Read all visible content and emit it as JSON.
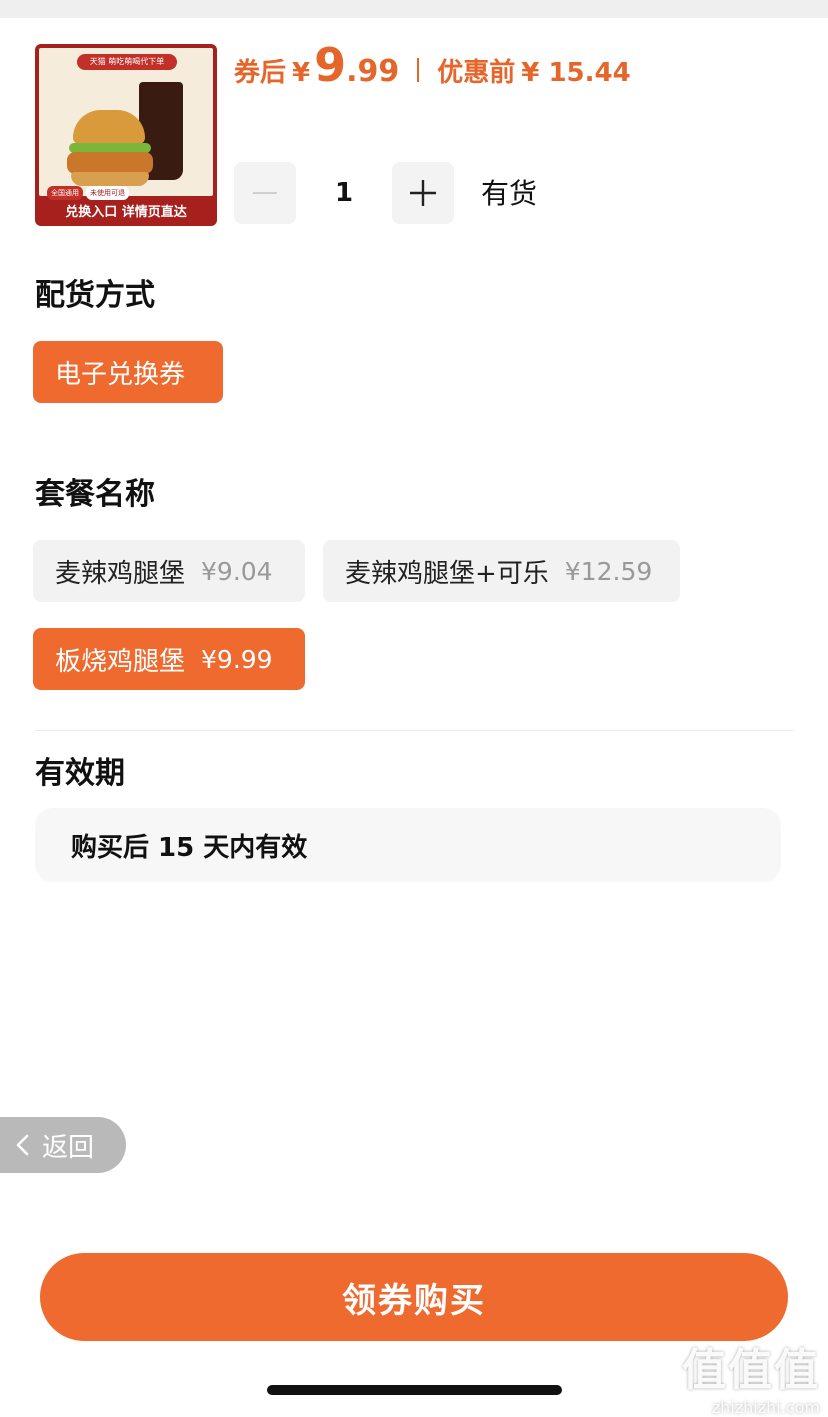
{
  "product": {
    "image_banner": "天猫 萌吃萌喝代下单",
    "image_tags": [
      "全国通用",
      "未使用可退"
    ],
    "image_caption": "兑换入口 详情页直达",
    "price_label": "券后",
    "currency": "¥",
    "price_int": "9",
    "price_dec": ".99",
    "original_label": "优惠前",
    "original_price": "¥ 15.44",
    "quantity": "1",
    "stock": "有货"
  },
  "delivery": {
    "title": "配货方式",
    "options": [
      {
        "label": "电子兑换券",
        "selected": true
      }
    ]
  },
  "package": {
    "title": "套餐名称",
    "options": [
      {
        "label": "麦辣鸡腿堡",
        "price": "¥9.04",
        "selected": false
      },
      {
        "label": "麦辣鸡腿堡+可乐",
        "price": "¥12.59",
        "selected": false
      },
      {
        "label": "板烧鸡腿堡",
        "price": "¥9.99",
        "selected": true
      }
    ]
  },
  "validity": {
    "title": "有效期",
    "text": "购买后 15 天内有效"
  },
  "back": {
    "label": "返回"
  },
  "buy_button": {
    "label": "领券购买"
  },
  "watermark": {
    "text": "值值值",
    "url": "zhizhizhi.com"
  },
  "colors": {
    "accent": "#ee6a2f",
    "price": "#e5652a",
    "chip_bg": "#f2f2f2"
  }
}
